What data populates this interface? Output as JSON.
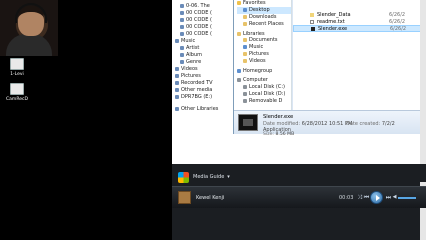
{
  "desktop": {
    "icons": [
      {
        "label": "1-Levi",
        "icon": "document-icon"
      },
      {
        "label": "CamRecD",
        "icon": "document-icon"
      }
    ]
  },
  "wmp": {
    "nav": [
      {
        "label": "0-06. The",
        "level": "indent",
        "icon": "music-note-icon"
      },
      {
        "label": "00 CODE (",
        "level": "indent",
        "icon": "music-note-icon"
      },
      {
        "label": "00 CODE (",
        "level": "indent",
        "icon": "music-note-icon"
      },
      {
        "label": "00 CODE (",
        "level": "indent",
        "icon": "music-note-icon"
      },
      {
        "label": "00 CODE (",
        "level": "indent",
        "icon": "music-note-icon"
      },
      {
        "label": "Music",
        "level": "top",
        "icon": "music-icon"
      },
      {
        "label": "Artist",
        "level": "indent",
        "icon": "artist-icon"
      },
      {
        "label": "Album",
        "level": "indent",
        "icon": "album-icon"
      },
      {
        "label": "Genre",
        "level": "indent",
        "icon": "genre-icon"
      },
      {
        "label": "Videos",
        "level": "top",
        "icon": "video-icon"
      },
      {
        "label": "Pictures",
        "level": "top",
        "icon": "picture-icon"
      },
      {
        "label": "Recorded TV",
        "level": "top",
        "icon": "tv-icon"
      },
      {
        "label": "Other media",
        "level": "top",
        "icon": "media-icon"
      },
      {
        "label": "DPR7BG (E:)",
        "level": "top",
        "icon": "drive-icon"
      },
      {
        "label": "Other Libraries",
        "level": "top",
        "icon": "library-icon"
      }
    ],
    "media_guide": "Media Guide",
    "now_playing": "Kewel Kenji",
    "time": "00:03"
  },
  "dialog": {
    "tree": [
      {
        "label": "Favorites",
        "kind": "star",
        "child": false,
        "gap": false,
        "selected": false
      },
      {
        "label": "Desktop",
        "kind": "blue",
        "child": true,
        "gap": false,
        "selected": true
      },
      {
        "label": "Downloads",
        "kind": "",
        "child": true,
        "gap": false,
        "selected": false
      },
      {
        "label": "Recent Places",
        "kind": "",
        "child": true,
        "gap": false,
        "selected": false
      },
      {
        "label": "Libraries",
        "kind": "",
        "child": false,
        "gap": true,
        "selected": false
      },
      {
        "label": "Documents",
        "kind": "",
        "child": true,
        "gap": false,
        "selected": false
      },
      {
        "label": "Music",
        "kind": "blue",
        "child": true,
        "gap": false,
        "selected": false
      },
      {
        "label": "Pictures",
        "kind": "",
        "child": true,
        "gap": false,
        "selected": false
      },
      {
        "label": "Videos",
        "kind": "",
        "child": true,
        "gap": false,
        "selected": false
      },
      {
        "label": "Homegroup",
        "kind": "blue",
        "child": false,
        "gap": true,
        "selected": false
      },
      {
        "label": "Computer",
        "kind": "grey",
        "child": false,
        "gap": true,
        "selected": false
      },
      {
        "label": "Local Disk (C:)",
        "kind": "grey",
        "child": true,
        "gap": false,
        "selected": false
      },
      {
        "label": "Local Disk (D:)",
        "kind": "grey",
        "child": true,
        "gap": false,
        "selected": false
      },
      {
        "label": "Removable D",
        "kind": "grey",
        "child": true,
        "gap": false,
        "selected": false
      }
    ],
    "files": [
      {
        "name": "Slender_Data",
        "date": "6/26/2",
        "kind": "folder",
        "selected": false
      },
      {
        "name": "readme.txt",
        "date": "6/26/2",
        "kind": "txt",
        "selected": false
      },
      {
        "name": "Slender.exe",
        "date": "6/26/2",
        "kind": "exe",
        "selected": true
      }
    ],
    "details": {
      "name": "Slender.exe",
      "modified_label": "Date modified:",
      "modified_value": "6/28/2012 10:51 PM",
      "created_label": "Date created:",
      "created_value": "7/2/2",
      "type": "Application",
      "size_label": "Size:",
      "size_value": "8.56 MB"
    }
  },
  "colors": {
    "selection": "#cce8ff",
    "player_accent": "#58a6e4"
  }
}
